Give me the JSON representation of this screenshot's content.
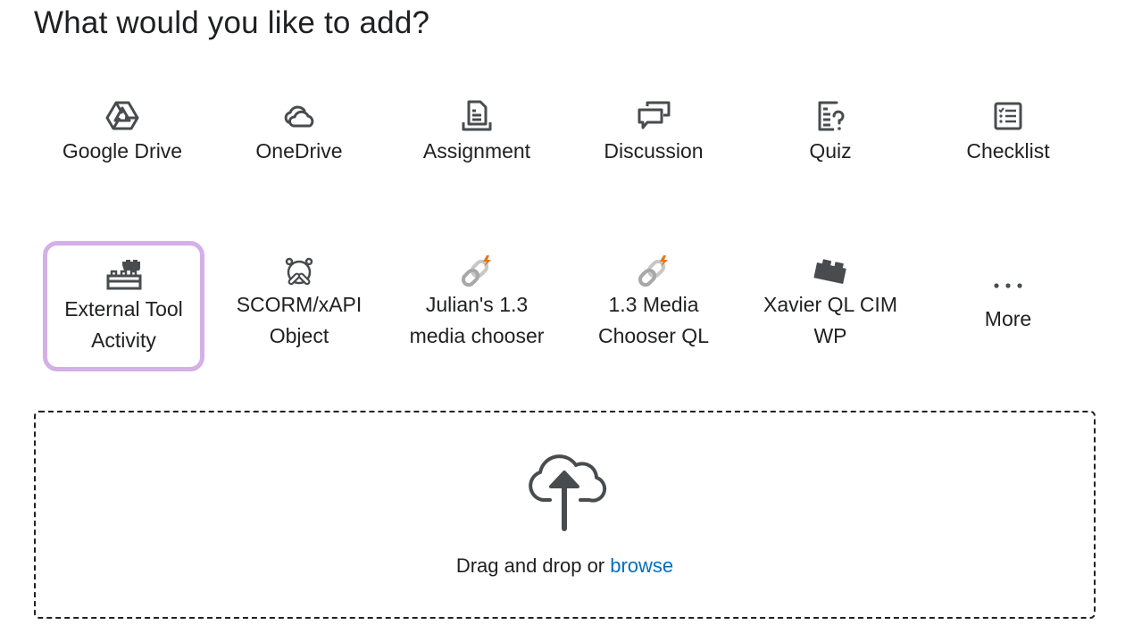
{
  "heading": "What would you like to add?",
  "tiles_row1": [
    {
      "label": "Google Drive",
      "icon": "google-drive-icon"
    },
    {
      "label": "OneDrive",
      "icon": "onedrive-icon"
    },
    {
      "label": "Assignment",
      "icon": "assignment-icon"
    },
    {
      "label": "Discussion",
      "icon": "discussion-icon"
    },
    {
      "label": "Quiz",
      "icon": "quiz-icon"
    },
    {
      "label": "Checklist",
      "icon": "checklist-icon"
    }
  ],
  "tiles_row2": [
    {
      "label_line1": "External Tool",
      "label_line2": "Activity",
      "icon": "lego-bricks-icon",
      "focused": true
    },
    {
      "label_line1": "SCORM/xAPI",
      "label_line2": "Object",
      "icon": "scorm-icon"
    },
    {
      "label_line1": "Julian's 1.3",
      "label_line2": "media chooser",
      "icon": "link-spark-icon"
    },
    {
      "label_line1": "1.3 Media",
      "label_line2": "Chooser QL",
      "icon": "link-spark-icon"
    },
    {
      "label_line1": "Xavier QL CIM",
      "label_line2": "WP",
      "icon": "lego-brick-icon"
    },
    {
      "label_line1": "More",
      "label_line2": "",
      "icon": "more-dots-icon"
    }
  ],
  "dropzone": {
    "text": "Drag and drop or ",
    "browse_label": "browse",
    "icon": "cloud-upload-icon"
  },
  "colors": {
    "focus_ring": "#d3b0e6",
    "icon_gray": "#494c4e",
    "link_blue": "#006fbf",
    "accent_orange": "#e87511"
  }
}
